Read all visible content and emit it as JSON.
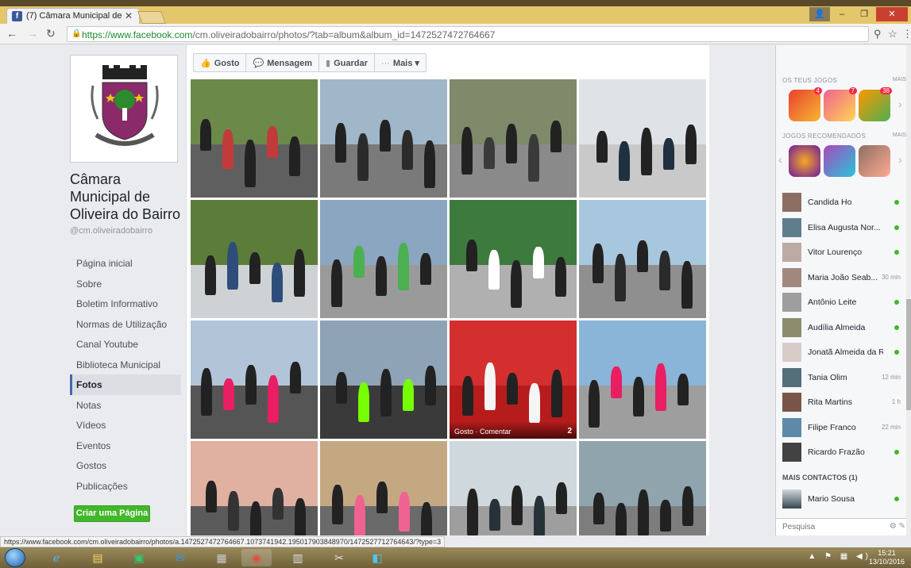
{
  "browser": {
    "tab_title": "(7) Câmara Municipal de",
    "tab_favicon": "f",
    "url_host": "https://www.facebook.com",
    "url_path": "/cm.oliveiradobairro/photos/?tab=album&album_id=1472527472764667",
    "status_url": "https://www.facebook.com/cm.oliveiradobairro/photos/a.1472527472764667.1073741942.195017903848970/1472527712764643/?type=3"
  },
  "page": {
    "name": "Câmara Municipal de Oliveira do Bairro",
    "handle": "@cm.oliveiradobairro",
    "nav": [
      {
        "label": "Página inicial"
      },
      {
        "label": "Sobre"
      },
      {
        "label": "Boletim Informativo"
      },
      {
        "label": "Normas de Utilização"
      },
      {
        "label": "Canal Youtube"
      },
      {
        "label": "Biblioteca Municipal"
      },
      {
        "label": "Fotos"
      },
      {
        "label": "Notas"
      },
      {
        "label": "Vídeos"
      },
      {
        "label": "Eventos"
      },
      {
        "label": "Gostos"
      },
      {
        "label": "Publicações"
      }
    ],
    "create_page": "Criar uma Página"
  },
  "actions": {
    "like": "Gosto",
    "message": "Mensagem",
    "save": "Guardar",
    "more": "Mais"
  },
  "photo_overlay": {
    "text": "Gosto · Comentar",
    "likes": "2"
  },
  "games": {
    "your_games": "OS TEUS JOGOS",
    "recommended": "JOGOS RECOMENDADOS",
    "more": "MAIS",
    "badges": [
      "4",
      "7",
      "38"
    ]
  },
  "contacts": [
    {
      "name": "Candida Ho",
      "status": ""
    },
    {
      "name": "Elisa Augusta Nor...",
      "status": ""
    },
    {
      "name": "Vitor Lourenço",
      "status": ""
    },
    {
      "name": "Maria João Seab...",
      "status": "30 min"
    },
    {
      "name": "Antônio Leite",
      "status": ""
    },
    {
      "name": "Audília Almeida",
      "status": ""
    },
    {
      "name": "Jonatã Almeida da R...",
      "status": ""
    },
    {
      "name": "Tania Olim",
      "status": "12 min"
    },
    {
      "name": "Rita Martins",
      "status": "1 h"
    },
    {
      "name": "Filipe Franco",
      "status": "22 min"
    },
    {
      "name": "Ricardo Frazão",
      "status": ""
    }
  ],
  "more_contacts": {
    "label": "MAIS CONTACTOS (1)",
    "name": "Mario Sousa"
  },
  "chat_search": {
    "placeholder": "Pesquisa"
  },
  "taskbar": {
    "time": "15:21",
    "date": "13/10/2016"
  }
}
